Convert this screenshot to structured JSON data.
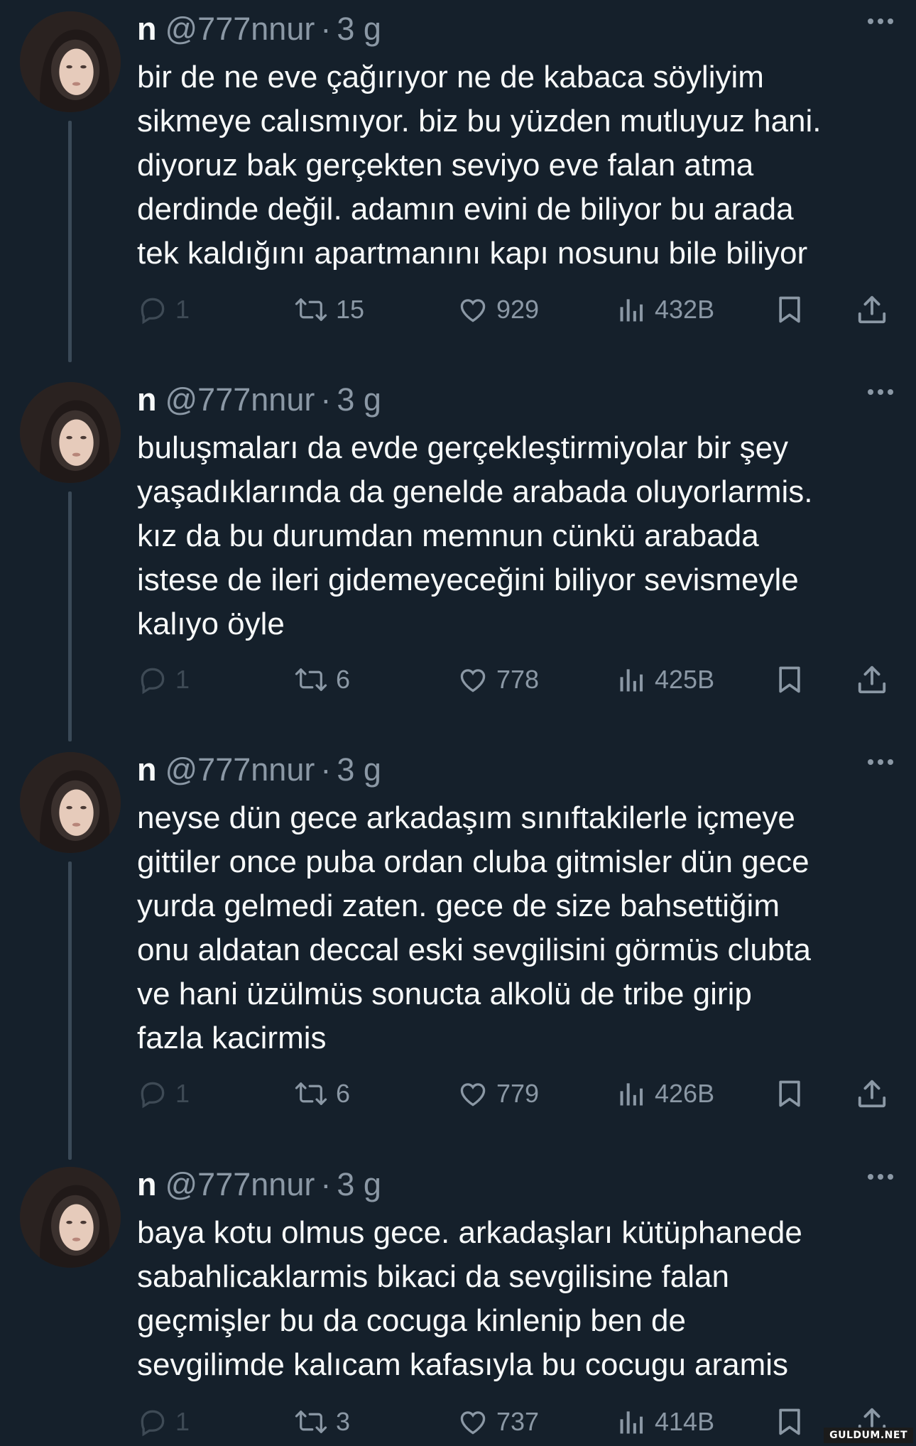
{
  "tweets": [
    {
      "name": "n",
      "handle": "@777nnur",
      "sep": "·",
      "time": "3 g",
      "text": "bir de ne eve çağırıyor ne de kabaca söyliyim\nsikmeye calısmıyor. biz bu yüzden mutluyuz hani.\ndiyoruz bak gerçekten seviyo eve falan atma\nderdinde değil. adamın evini de biliyor bu arada\ntek kaldığını apartmanını kapı nosunu bile biliyor",
      "replies": "1",
      "retweets": "15",
      "likes": "929",
      "views": "432B"
    },
    {
      "name": "n",
      "handle": "@777nnur",
      "sep": "·",
      "time": "3 g",
      "text": "buluşmaları da evde gerçekleştirmiyolar bir şey\nyaşadıklarında da genelde arabada oluyorlarmis.\nkız da bu durumdan memnun cünkü arabada\nistese de ileri gidemeyeceğini biliyor sevismeyle\nkalıyo öyle",
      "replies": "1",
      "retweets": "6",
      "likes": "778",
      "views": "425B"
    },
    {
      "name": "n",
      "handle": "@777nnur",
      "sep": "·",
      "time": "3 g",
      "text": "neyse dün gece arkadaşım sınıftakilerle içmeye\ngittiler once puba ordan cluba gitmisler dün gece\nyurda gelmedi zaten. gece  de size bahsettiğim\nonu aldatan deccal eski sevgilisini görmüs clubta\nve hani üzülmüs sonucta alkolü de tribe girip\nfazla kacirmis",
      "replies": "1",
      "retweets": "6",
      "likes": "779",
      "views": "426B"
    },
    {
      "name": "n",
      "handle": "@777nnur",
      "sep": "·",
      "time": "3 g",
      "text": "baya kotu olmus gece. arkadaşları kütüphanede\nsabahlicaklarmis bikaci da sevgilisine falan\ngeçmişler bu da cocuga kinlenip ben de\nsevgilimde kalıcam kafasıyla bu cocugu aramis",
      "replies": "1",
      "retweets": "3",
      "likes": "737",
      "views": "414B"
    }
  ],
  "icons": {
    "reply": "reply-icon",
    "retweet": "retweet-icon",
    "like": "heart-icon",
    "views": "views-icon",
    "bookmark": "bookmark-icon",
    "share": "share-icon",
    "more": "more-icon"
  },
  "colors": {
    "background": "#15202b",
    "text": "#f7f9f9",
    "secondary": "#8b98a5",
    "thread_line": "#3a4957"
  },
  "watermark": "GULDUM.NET"
}
